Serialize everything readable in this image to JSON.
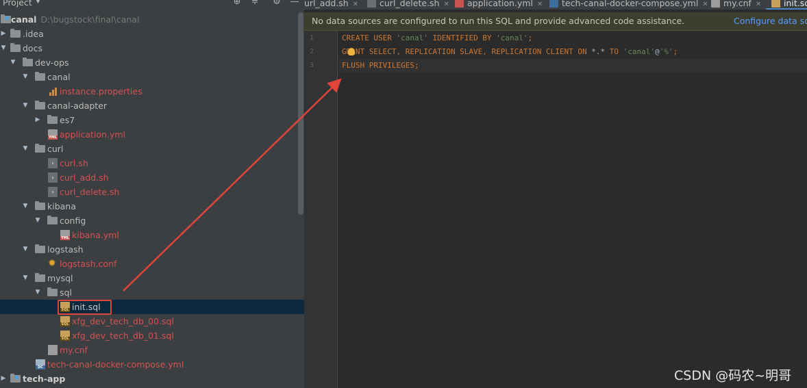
{
  "panel": {
    "title": "Project",
    "header_icons": [
      "crosshair-icon",
      "collapse-icon",
      "gear-icon",
      "minimize-icon"
    ]
  },
  "tree": {
    "root": {
      "name": "canal",
      "path": "D:\\bugstock\\final\\canal"
    },
    "idea": ".idea",
    "docs": "docs",
    "devops": "dev-ops",
    "canal_folder": "canal",
    "instance_properties": "instance.properties",
    "canal_adapter": "canal-adapter",
    "es7": "es7",
    "application_yml": "application.yml",
    "curl": "curl",
    "curl_sh": "curl.sh",
    "curl_add_sh": "curl_add.sh",
    "curl_delete_sh": "curl_delete.sh",
    "kibana": "kibana",
    "config": "config",
    "kibana_yml": "kibana.yml",
    "logstash": "logstash",
    "logstash_conf": "logstash.conf",
    "mysql": "mysql",
    "sql": "sql",
    "init_sql": "init.sql",
    "db00_sql": "xfg_dev_tech_db_00.sql",
    "db01_sql": "xfg_dev_tech_db_01.sql",
    "my_cnf": "my.cnf",
    "compose_yml": "tech-canal-docker-compose.yml",
    "tech_app": "tech-app"
  },
  "tabs": [
    {
      "label": "url_add.sh",
      "icon": "shell-file-icon"
    },
    {
      "label": "curl_delete.sh",
      "icon": "shell-file-icon"
    },
    {
      "label": "application.yml",
      "icon": "yml-file-icon"
    },
    {
      "label": "tech-canal-docker-compose.yml",
      "icon": "docker-compose-icon"
    },
    {
      "label": "my.cnf",
      "icon": "cnf-file-icon"
    },
    {
      "label": "init.sq",
      "icon": "sql-file-icon",
      "active": true
    }
  ],
  "notice": {
    "text": "No data sources are configured to run this SQL and provide advanced code assistance.",
    "link": "Configure data sou"
  },
  "code": {
    "line_numbers": [
      "1",
      "2",
      "3"
    ],
    "line1": {
      "kw1": "CREATE USER ",
      "s1": "'canal'",
      "kw2": " IDENTIFIED BY ",
      "s2": "'canal'",
      "end": ";"
    },
    "line2": {
      "kw1": "GRANT SELECT, REPLICATION SLAVE, REPLICATION CLIENT ON ",
      "p1": "*.*",
      "kw2": " TO ",
      "s1": "'canal'",
      "p2": "@",
      "s2": "'%'",
      "end": ";"
    },
    "line3": {
      "kw1": "FLUSH PRIVILEGES",
      "end": ";"
    }
  },
  "colors": {
    "keyword": "#cc7832",
    "string": "#6a8759",
    "file_modified": "#d25252",
    "selection": "#0d293e",
    "highlight_box": "#e0443a",
    "annotation_arrow": "#e0443a"
  },
  "watermark": "CSDN @码农~明哥"
}
